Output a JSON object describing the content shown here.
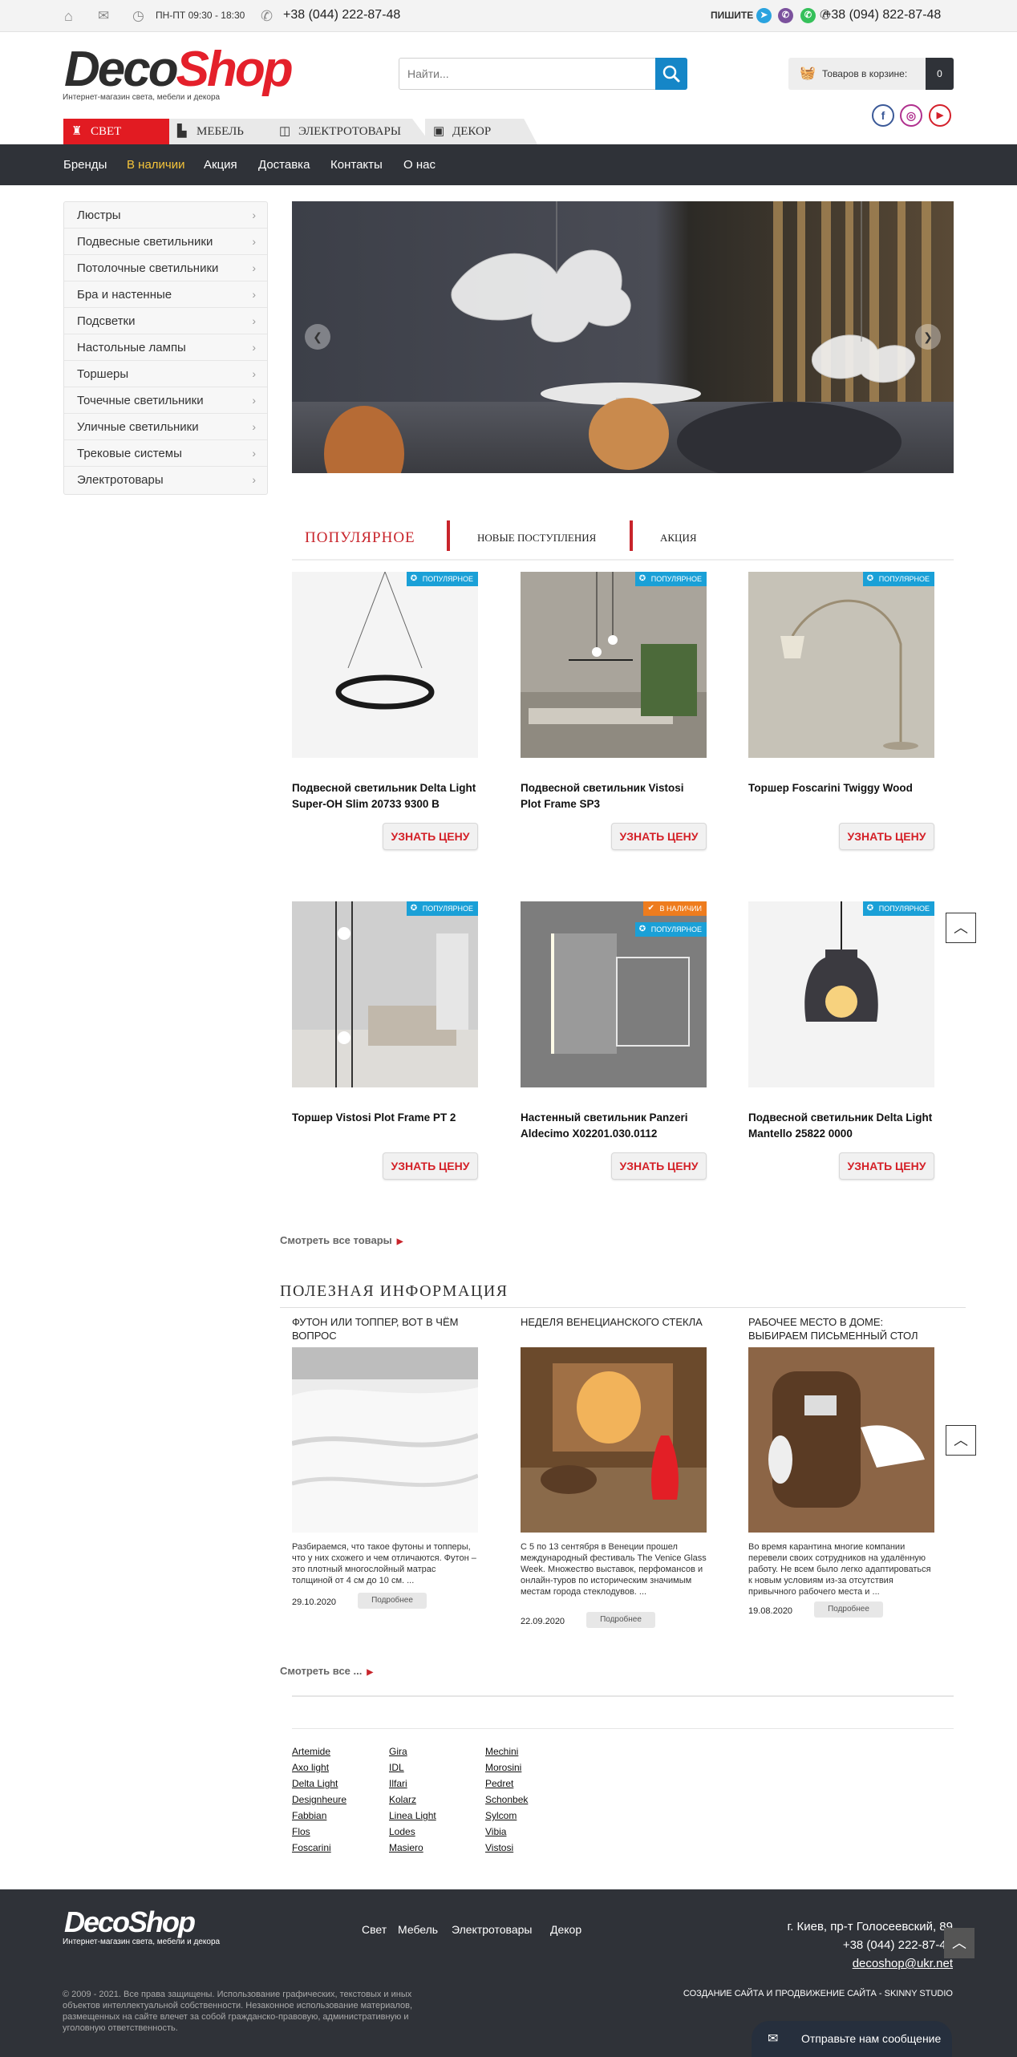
{
  "topbar": {
    "hours": "ПН-ПТ 09:30 - 18:30",
    "phone1": "+38 (044) 222-87-48",
    "write_label": "ПИШИТЕ",
    "phone2": "+38 (094) 822-87-48",
    "icons": [
      "home-icon",
      "mail-icon",
      "clock-icon",
      "phone-icon",
      "telegram-icon",
      "viber-icon",
      "whatsapp-icon"
    ]
  },
  "header": {
    "logo_deco": "Deco",
    "logo_shop": "Shop",
    "logo_sub": "Интернет-магазин света, мебели и декора",
    "search_placeholder": "Найти...",
    "cart_label": "Товаров в корзине:",
    "cart_count": "0",
    "social": [
      "f",
      "◎",
      "▶"
    ]
  },
  "category_tabs": [
    "СВЕТ",
    "МЕБЕЛЬ",
    "ЭЛЕКТРОТОВАРЫ",
    "ДЕКОР"
  ],
  "nav": [
    "Бренды",
    "В наличии",
    "Акция",
    "Доставка",
    "Контакты",
    "О нас"
  ],
  "sidebar": [
    "Люстры",
    "Подвесные светильники",
    "Потолочные светильники",
    "Бра и настенные",
    "Подсветки",
    "Настольные лампы",
    "Торшеры",
    "Точечные светильники",
    "Уличные светильники",
    "Трековые системы",
    "Электротовары"
  ],
  "product_tabs": [
    "ПОПУЛЯРНОЕ",
    "НОВЫЕ ПОСТУПЛЕНИЯ",
    "АКЦИЯ"
  ],
  "products": [
    {
      "name": "Подвесной светильник Delta Light Super-OH Slim 20733 9300 B",
      "badge": "ПОПУЛЯРНОЕ",
      "price_btn": "УЗНАТЬ ЦЕНУ"
    },
    {
      "name": "Подвесной светильник Vistosi Plot Frame SP3",
      "badge": "ПОПУЛЯРНОЕ",
      "price_btn": "УЗНАТЬ ЦЕНУ"
    },
    {
      "name": "Торшер Foscarini Twiggy Wood",
      "badge": "ПОПУЛЯРНОЕ",
      "price_btn": "УЗНАТЬ ЦЕНУ"
    },
    {
      "name": "Торшер Vistosi Plot Frame PT 2",
      "badge": "ПОПУЛЯРНОЕ",
      "price_btn": "УЗНАТЬ ЦЕНУ"
    },
    {
      "name": "Настенный светильник Panzeri Aldecimo X02201.030.0112",
      "badge": "ПОПУЛЯРНОЕ",
      "badge2": "В НАЛИЧИИ",
      "price_btn": "УЗНАТЬ ЦЕНУ"
    },
    {
      "name": "Подвесной светильник Delta Light Mantello 25822 0000",
      "badge": "ПОПУЛЯРНОЕ",
      "price_btn": "УЗНАТЬ ЦЕНУ"
    }
  ],
  "view_all_products": "Смотреть все товары",
  "info": {
    "title": "ПОЛЕЗНАЯ ИНФОРМАЦИЯ",
    "articles": [
      {
        "title": "ФУТОН ИЛИ ТОППЕР, ВОТ В ЧЁМ ВОПРОС",
        "text": "Разбираемся, что такое футоны и топперы, что у них схожего и чем отличаются. Футон – это плотный многослойный матрас толщиной от 4 см до 10 см. ...",
        "date": "29.10.2020",
        "more": "Подробнее"
      },
      {
        "title": "НЕДЕЛЯ ВЕНЕЦИАНСКОГО СТЕКЛА",
        "text": "С 5 по 13 сентября в Венеции прошел международный фестиваль The Venice Glass Week. Множество выставок, перфомансов и онлайн-туров по историческим значимым местам города стеклодувов. ...",
        "date": "22.09.2020",
        "more": "Подробнее"
      },
      {
        "title": "РАБОЧЕЕ МЕСТО В ДОМЕ: ВЫБИРАЕМ ПИСЬМЕННЫЙ СТОЛ",
        "text": "Во время карантина многие компании перевели своих сотрудников на удалённую работу. Не всем было легко адаптироваться к новым условиям из-за отсутствия привычного рабочего места и ...",
        "date": "19.08.2020",
        "more": "Подробнее"
      }
    ],
    "view_all": "Смотреть все ..."
  },
  "brands": [
    [
      "Artemide",
      "Axo light",
      "Delta Light",
      "Designheure",
      "Fabbian",
      "Flos",
      "Foscarini"
    ],
    [
      "Gira",
      "IDL",
      "Ilfari",
      "Kolarz",
      "Linea Light",
      "Lodes",
      "Masiero"
    ],
    [
      "Mechini",
      "Morosini",
      "Pedret",
      "Schonbek",
      "Sylcom",
      "Vibia",
      "Vistosi"
    ]
  ],
  "footer": {
    "logo": "DecoShop",
    "logo_sub": "Интернет-магазин света, мебели и декора",
    "links": [
      "Свет",
      "Мебель",
      "Электротовары",
      "Декор"
    ],
    "address": "г. Киев, пр-т Голосеевский, 89",
    "phone": "+38 (044) 222-87-48",
    "email": "decoshop@ukr.net",
    "copyright": "© 2009 - 2021. Все права защищены. Использование графических, текстовых и иных объектов интеллектуальной собственности. Незаконное использование материалов, размещенных на сайте влечет за собой гражданско-правовую, административную и уголовную ответственность.",
    "studio": "СОЗДАНИЕ САЙТА И ПРОДВИЖЕНИЕ САЙТА - SKINNY STUDIO",
    "send_message": "Отправьте нам сообщение"
  }
}
